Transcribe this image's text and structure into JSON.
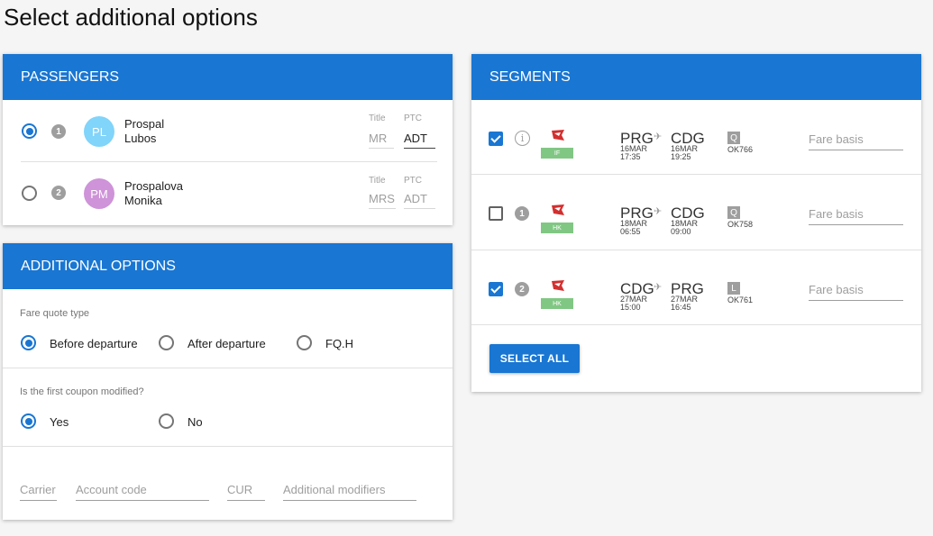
{
  "page_title": "Select additional options",
  "passengers": {
    "header": "PASSENGERS",
    "items": [
      {
        "number": "1",
        "initials": "PL",
        "avatar_color": "#81d4fa",
        "last_name": "Prospal",
        "first_name": "Lubos",
        "title_label": "Title",
        "title_value": "MR",
        "ptc_label": "PTC",
        "ptc_value": "ADT",
        "selected": true
      },
      {
        "number": "2",
        "initials": "PM",
        "avatar_color": "#ce93d8",
        "last_name": "Prospalova",
        "first_name": "Monika",
        "title_label": "Title",
        "title_value": "MRS",
        "ptc_label": "PTC",
        "ptc_value": "ADT",
        "selected": false
      }
    ]
  },
  "additional_options": {
    "header": "ADDITIONAL OPTIONS",
    "fare_quote_type": {
      "label": "Fare quote type",
      "options": [
        "Before departure",
        "After departure",
        "FQ.H"
      ],
      "selected": "Before departure"
    },
    "first_coupon": {
      "label": "Is the first coupon modified?",
      "options": [
        "Yes",
        "No"
      ],
      "selected": "Yes"
    },
    "fields": {
      "carrier_placeholder": "Carrier",
      "account_code_placeholder": "Account code",
      "currency_placeholder": "CUR",
      "modifiers_placeholder": "Additional modifiers"
    }
  },
  "segments": {
    "header": "SEGMENTS",
    "items": [
      {
        "checked": true,
        "marker": "i",
        "status": "IF",
        "from": "PRG",
        "to": "CDG",
        "dep_date": "16MAR",
        "dep_time": "17:35",
        "arr_date": "16MAR",
        "arr_time": "19:25",
        "class": "Q",
        "flight": "OK766",
        "fare_basis_placeholder": "Fare basis"
      },
      {
        "checked": false,
        "marker": "1",
        "status": "HK",
        "from": "PRG",
        "to": "CDG",
        "dep_date": "18MAR",
        "dep_time": "06:55",
        "arr_date": "18MAR",
        "arr_time": "09:00",
        "class": "Q",
        "flight": "OK758",
        "fare_basis_placeholder": "Fare basis"
      },
      {
        "checked": true,
        "marker": "2",
        "status": "HK",
        "from": "CDG",
        "to": "PRG",
        "dep_date": "27MAR",
        "dep_time": "15:00",
        "arr_date": "27MAR",
        "arr_time": "16:45",
        "class": "L",
        "flight": "OK761",
        "fare_basis_placeholder": "Fare basis"
      }
    ],
    "select_all_label": "SELECT ALL"
  },
  "colors": {
    "primary": "#1976d2",
    "status_green": "#81c784",
    "airline_red": "#d32f2f"
  }
}
